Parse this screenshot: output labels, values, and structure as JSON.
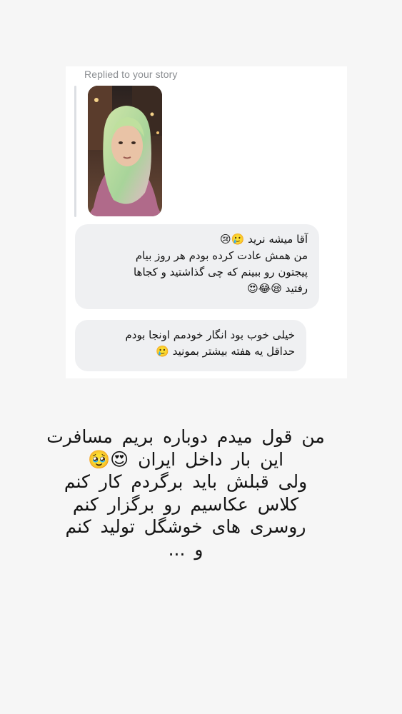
{
  "reply": {
    "header": "Replied to your story"
  },
  "messages": [
    {
      "lines": [
        "آقا میشه نرید 🥲😢",
        "من همش عادت کرده بودم هر روز بیام",
        "پیجتون رو ببینم که چی گذاشتید و کجاها",
        "رفتید 😪😂😍"
      ]
    },
    {
      "lines": [
        "خیلی خوب بود انگار خودمم اونجا بودم",
        "حداقل یه هفته بیشتر بمونید 🥲"
      ]
    }
  ],
  "caption": {
    "lines": [
      "من قول میدم دوباره بریم مسافرت",
      "این بار داخل ایران 😍🥹",
      "ولی قبلش باید برگردم کار کنم",
      "کلاس عکاسیم رو برگزار کنم",
      "روسری های خوشگل تولید کنم",
      "و ..."
    ]
  },
  "colors": {
    "background": "#f6f6f6",
    "card": "#ffffff",
    "bubble": "#eff0f2",
    "header_text": "#8a8d91"
  }
}
